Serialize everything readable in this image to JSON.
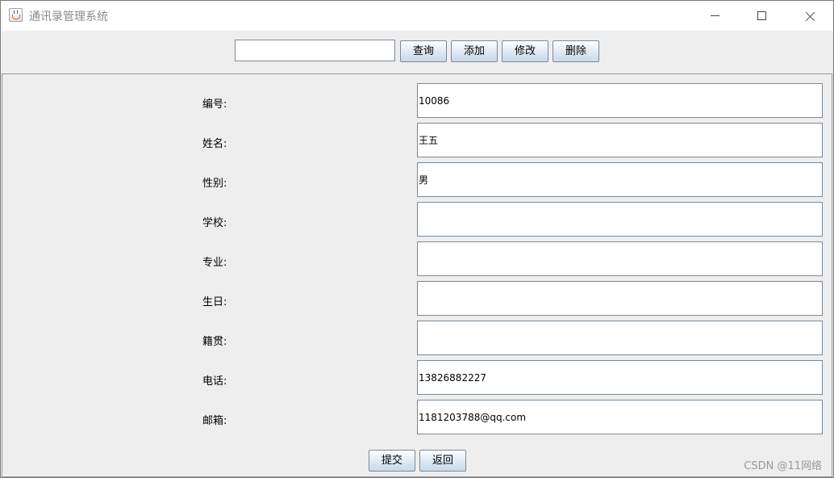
{
  "window": {
    "title": "通讯录管理系统",
    "icon": "java-cup-icon",
    "controls": [
      "minimize-icon",
      "maximize-icon",
      "close-icon"
    ]
  },
  "toolbar": {
    "search_value": "",
    "query_label": "查询",
    "add_label": "添加",
    "edit_label": "修改",
    "delete_label": "删除"
  },
  "form": {
    "fields": [
      {
        "label": "编号:",
        "value": "10086"
      },
      {
        "label": "姓名:",
        "value": "王五"
      },
      {
        "label": "性别:",
        "value": "男"
      },
      {
        "label": "学校:",
        "value": ""
      },
      {
        "label": "专业:",
        "value": ""
      },
      {
        "label": "生日:",
        "value": ""
      },
      {
        "label": "籍贯:",
        "value": ""
      },
      {
        "label": "电话:",
        "value": "13826882227"
      },
      {
        "label": "邮箱:",
        "value": "1181203788@qq.com"
      }
    ],
    "submit_label": "提交",
    "back_label": "返回"
  },
  "watermark": "CSDN @11网络"
}
